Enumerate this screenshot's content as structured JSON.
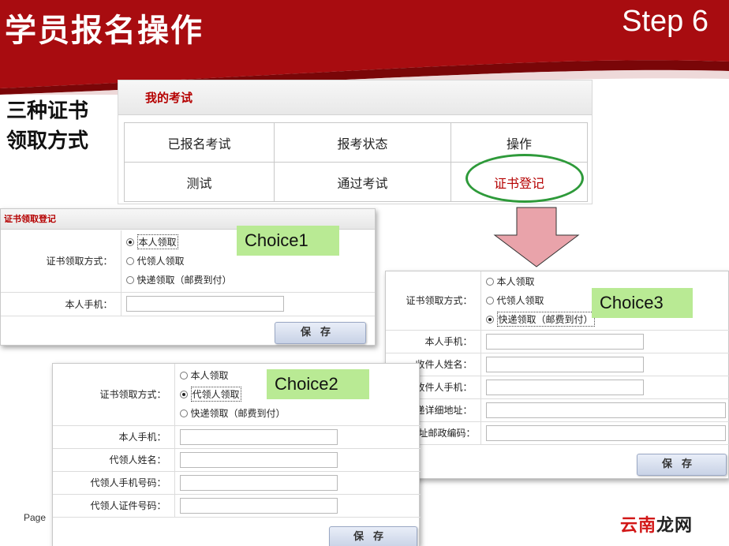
{
  "slide": {
    "title": "学员报名操作",
    "step": "Step 6",
    "side_heading_line1": "三种证书",
    "side_heading_line2": "领取方式",
    "page_label": "Page"
  },
  "my_exams": {
    "title": "我的考试",
    "rows": [
      [
        "已报名考试",
        "报考状态",
        "操作"
      ],
      [
        "测试",
        "通过考试",
        "证书登记"
      ]
    ]
  },
  "choice_tags": {
    "choice1": "Choice1",
    "choice2": "Choice2",
    "choice3": "Choice3"
  },
  "form1": {
    "title": "证书领取登记",
    "method_label": "证书领取方式：",
    "options": [
      "本人领取",
      "代领人领取",
      "快递领取（邮费到付）"
    ],
    "selected": 0,
    "phone_label": "本人手机：",
    "save_label": "保存"
  },
  "form2": {
    "method_label": "证书领取方式：",
    "options": [
      "本人领取",
      "代领人领取",
      "快递领取（邮费到付）"
    ],
    "selected": 1,
    "fields": [
      "本人手机：",
      "代领人姓名：",
      "代领人手机号码：",
      "代领人证件号码："
    ],
    "save_label": "保存"
  },
  "form3": {
    "method_label": "证书领取方式：",
    "options": [
      "本人领取",
      "代领人领取",
      "快递领取（邮费到付）"
    ],
    "selected": 2,
    "fields": [
      "本人手机：",
      "收件人姓名：",
      "收件人手机：",
      "快递详细地址：",
      "快递地址邮政编码："
    ],
    "save_label": "保存"
  },
  "watermark": {
    "part1": "云南",
    "part2": "龙网"
  },
  "colors": {
    "banner_red": "#a80c10",
    "accent_red": "#b50000",
    "choice_green": "#b9ea94",
    "oval_green": "#2e9a3a",
    "arrow_pink": "#e9a3aa"
  }
}
